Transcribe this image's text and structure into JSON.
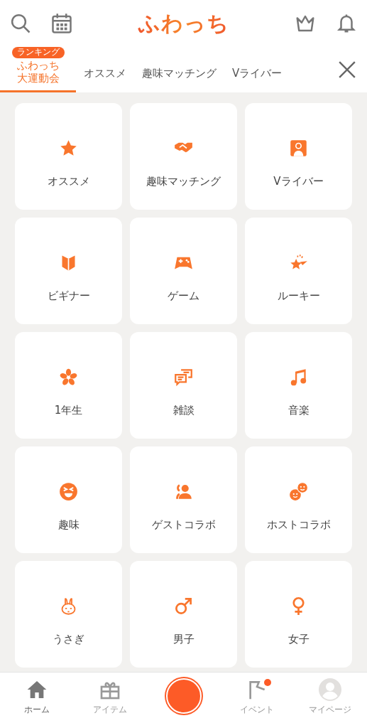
{
  "header": {
    "logo": "ふわっち"
  },
  "tabs": [
    {
      "label": "ふわっち大運動会",
      "badge": "ランキング",
      "selected": true
    },
    {
      "label": "オススメ",
      "selected": false
    },
    {
      "label": "趣味マッチング",
      "selected": false
    },
    {
      "label": "Vライバー",
      "selected": false
    }
  ],
  "categories": [
    {
      "label": "オススメ"
    },
    {
      "label": "趣味マッチング"
    },
    {
      "label": "Vライバー"
    },
    {
      "label": "ビギナー"
    },
    {
      "label": "ゲーム"
    },
    {
      "label": "ルーキー"
    },
    {
      "label": "1年生"
    },
    {
      "label": "雑談"
    },
    {
      "label": "音楽"
    },
    {
      "label": "趣味"
    },
    {
      "label": "ゲストコラボ"
    },
    {
      "label": "ホストコラボ"
    },
    {
      "label": "うさぎ"
    },
    {
      "label": "男子"
    },
    {
      "label": "女子"
    }
  ],
  "bottom_nav": [
    {
      "kind": "tab",
      "label": "ホーム",
      "selected": true,
      "notification": false
    },
    {
      "kind": "tab",
      "label": "アイテム",
      "selected": false,
      "notification": false
    },
    {
      "kind": "record"
    },
    {
      "kind": "tab",
      "label": "イベント",
      "selected": false,
      "notification": true
    },
    {
      "kind": "tab",
      "label": "マイページ",
      "selected": false,
      "notification": false
    }
  ]
}
